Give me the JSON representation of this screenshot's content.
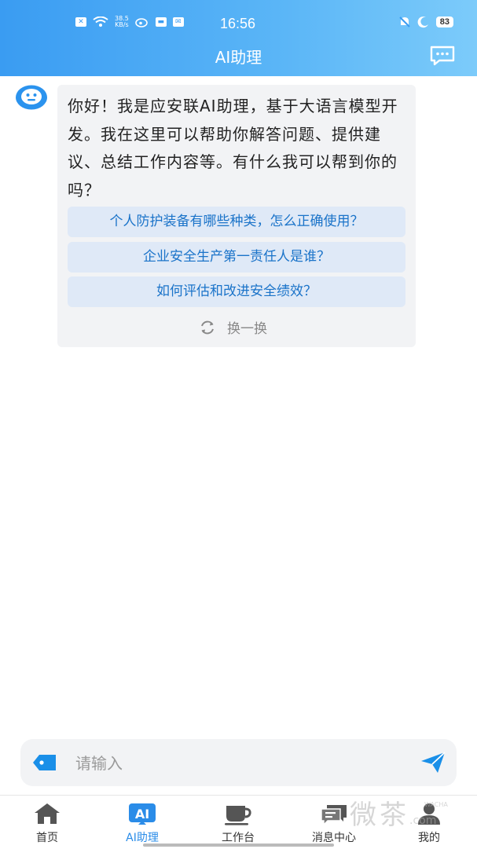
{
  "status_bar": {
    "speed": "38.5\nKB/s",
    "time": "16:56",
    "battery": "83"
  },
  "header": {
    "title": "AI助理"
  },
  "chat": {
    "greeting": "你好！我是应安联AI助理，基于大语言模型开发。我在这里可以帮助你解答问题、提供建议、总结工作内容等。有什么我可以帮到你的吗？",
    "suggestions": [
      "个人防护装备有哪些种类，怎么正确使用？",
      "企业安全生产第一责任人是谁？",
      "如何评估和改进安全绩效？"
    ],
    "refresh_label": "换一换"
  },
  "input": {
    "placeholder": "请输入"
  },
  "tabs": [
    {
      "label": "首页",
      "icon": "home-icon"
    },
    {
      "label": "AI助理",
      "icon": "ai-icon",
      "active": true
    },
    {
      "label": "工作台",
      "icon": "cup-icon"
    },
    {
      "label": "消息中心",
      "icon": "message-icon"
    },
    {
      "label": "我的",
      "icon": "user-icon"
    }
  ],
  "watermark": {
    "text": "微茶",
    "sub": "WACHA",
    "domain": ".com"
  },
  "colors": {
    "header": "#3a9cf2",
    "accent": "#2a8ce8",
    "suggest_bg": "#dfe9f7"
  }
}
